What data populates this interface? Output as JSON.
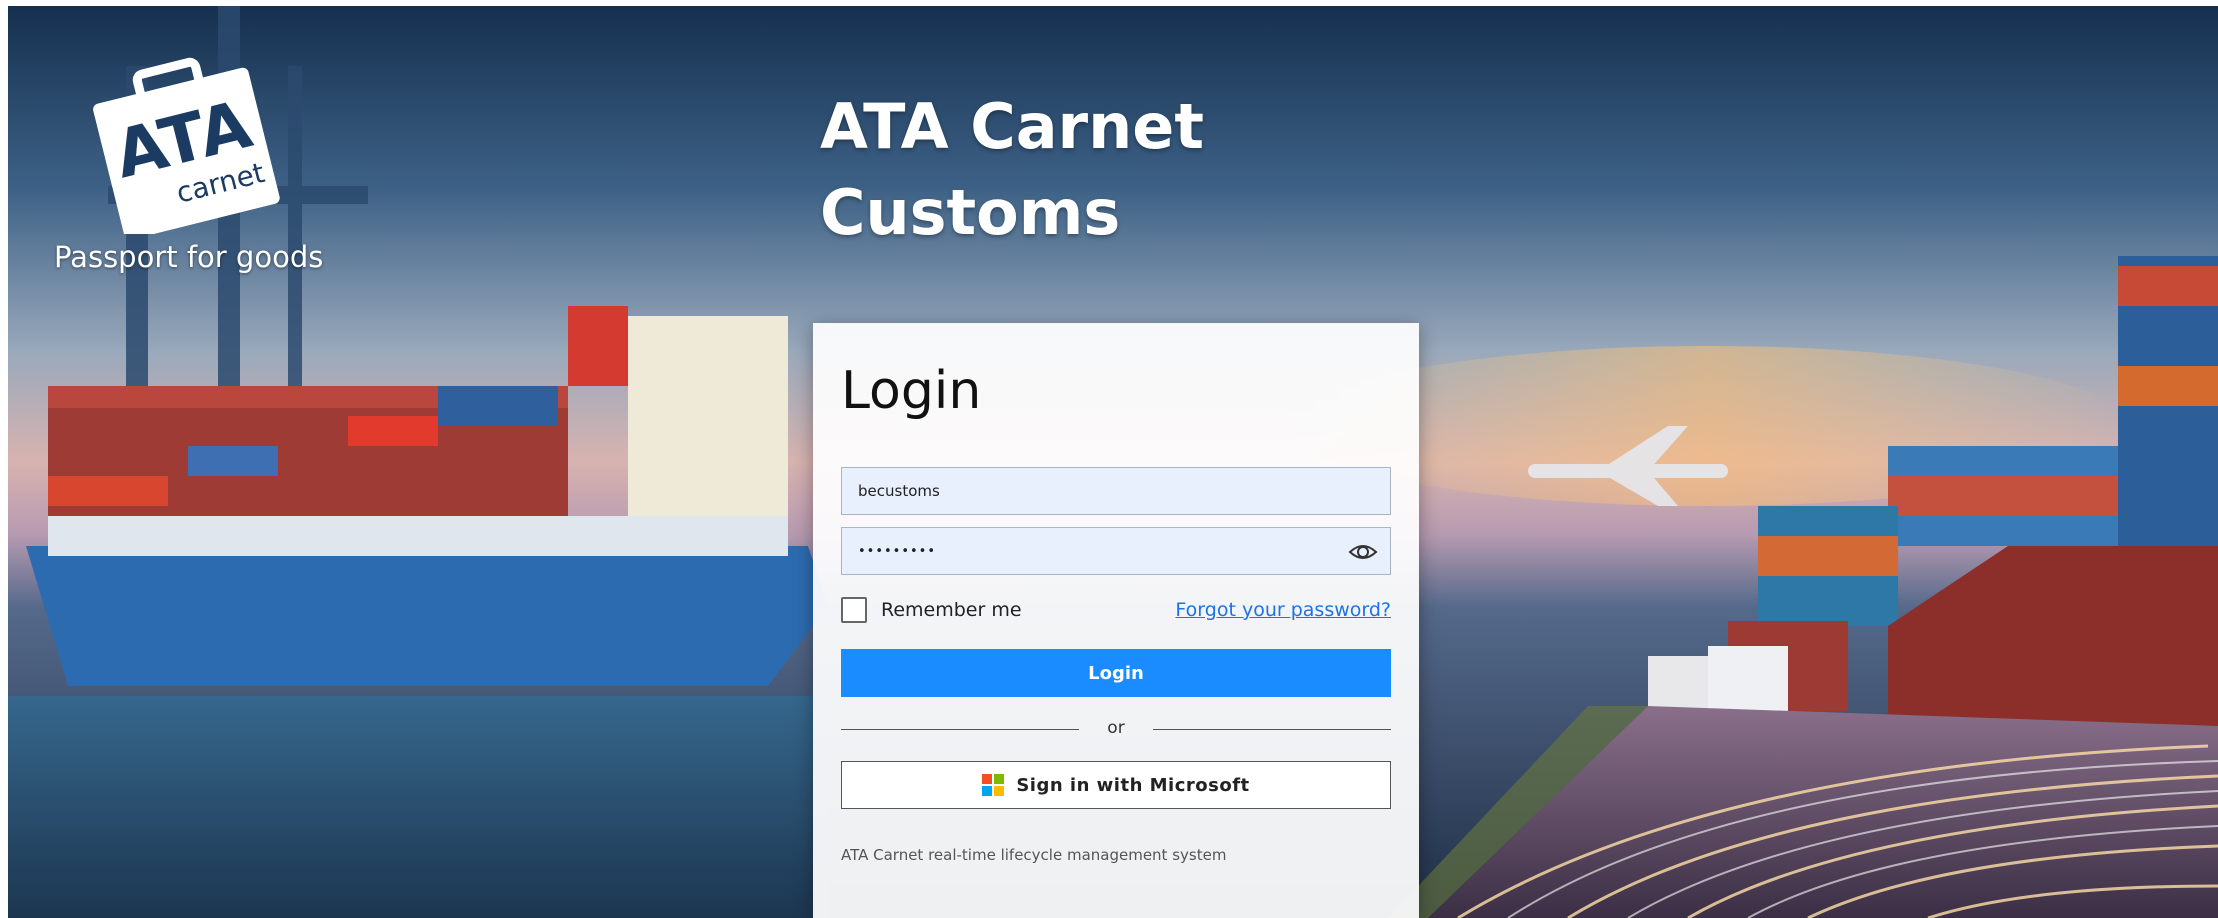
{
  "brand": {
    "logo_text": "ATA",
    "logo_subtext": "carnet",
    "tagline": "Passport for goods"
  },
  "hero": {
    "title_line1": "ATA Carnet",
    "title_line2": "Customs"
  },
  "login": {
    "heading": "Login",
    "username_value": "becustoms",
    "password_value": "•••••••••",
    "password_toggle_icon": "eye-icon",
    "remember_label": "Remember me",
    "remember_checked": false,
    "forgot_link": "Forgot your password?",
    "submit_label": "Login",
    "divider_text": "or",
    "microsoft_label": "Sign in with Microsoft",
    "microsoft_icon": "microsoft-logo-icon",
    "footnote": "ATA Carnet real-time lifecycle management system"
  },
  "colors": {
    "primary_button": "#1a8cff",
    "link": "#1a73e8",
    "field_bg": "#e8f0fe",
    "microsoft_red": "#f25022",
    "microsoft_green": "#7fba00",
    "microsoft_blue": "#00a4ef",
    "microsoft_yellow": "#ffb900"
  }
}
